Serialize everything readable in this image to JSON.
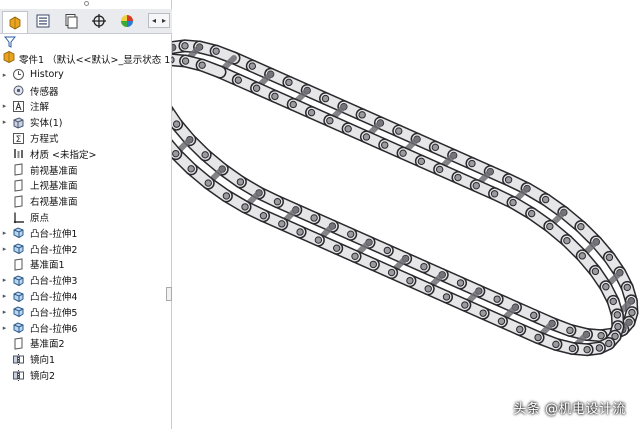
{
  "feature_tree": {
    "root_label": "零件1 （默认<<默认>_显示状态 1>）",
    "items": [
      {
        "label": "History",
        "icon": "history-icon",
        "expandable": true
      },
      {
        "label": "传感器",
        "icon": "sensor-icon",
        "expandable": false
      },
      {
        "label": "注解",
        "icon": "annotation-icon",
        "expandable": true
      },
      {
        "label": "实体(1)",
        "icon": "solid-body-icon",
        "expandable": true
      },
      {
        "label": "方程式",
        "icon": "equation-icon",
        "expandable": false
      },
      {
        "label": "材质 <未指定>",
        "icon": "material-icon",
        "expandable": false
      },
      {
        "label": "前视基准面",
        "icon": "plane-icon",
        "expandable": false
      },
      {
        "label": "上视基准面",
        "icon": "plane-icon",
        "expandable": false
      },
      {
        "label": "右视基准面",
        "icon": "plane-icon",
        "expandable": false
      },
      {
        "label": "原点",
        "icon": "origin-icon",
        "expandable": false
      },
      {
        "label": "凸台-拉伸1",
        "icon": "extrude-icon",
        "expandable": true
      },
      {
        "label": "凸台-拉伸2",
        "icon": "extrude-icon",
        "expandable": true
      },
      {
        "label": "基准面1",
        "icon": "plane-icon",
        "expandable": false
      },
      {
        "label": "凸台-拉伸3",
        "icon": "extrude-icon",
        "expandable": true
      },
      {
        "label": "凸台-拉伸4",
        "icon": "extrude-icon",
        "expandable": true
      },
      {
        "label": "凸台-拉伸5",
        "icon": "extrude-icon",
        "expandable": true
      },
      {
        "label": "凸台-拉伸6",
        "icon": "extrude-icon",
        "expandable": true
      },
      {
        "label": "基准面2",
        "icon": "plane-icon",
        "expandable": false
      },
      {
        "label": "镜向1",
        "icon": "mirror-icon",
        "expandable": false
      },
      {
        "label": "镜向2",
        "icon": "mirror-icon",
        "expandable": false
      }
    ]
  },
  "tabs": [
    "feature-manager-tab",
    "property-manager-tab",
    "configuration-manager-tab",
    "dimxpert-tab",
    "display-manager-tab"
  ],
  "watermark": "头条 @机电设计流",
  "colors": {
    "panel_bg": "#ffffff",
    "tab_bg": "#e9ebef",
    "chain_light": "#e6e6e8",
    "chain_dark": "#2a2a2e"
  }
}
